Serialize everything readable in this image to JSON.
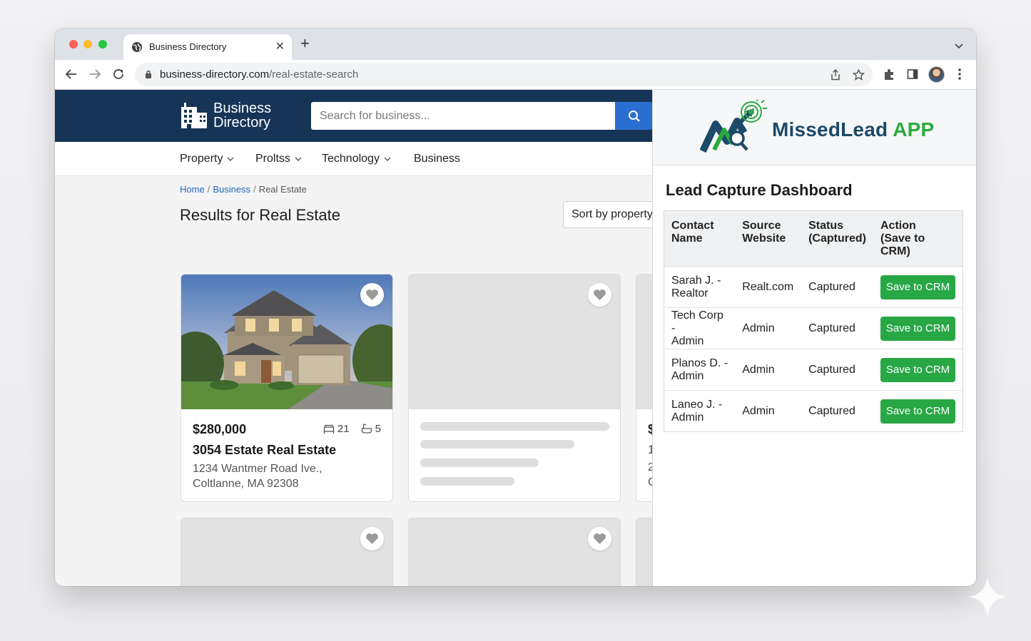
{
  "browser": {
    "tab_title": "Business Directory",
    "url_host": "business-directory.com",
    "url_path": "/real-estate-search"
  },
  "site": {
    "brand_line1": "Business",
    "brand_line2": "Directory",
    "search_placeholder": "Search for business...",
    "nav": [
      {
        "label": "Property"
      },
      {
        "label": "Proltss"
      },
      {
        "label": "Technology"
      },
      {
        "label": "Business"
      }
    ],
    "breadcrumb": {
      "home": "Home",
      "business": "Business",
      "current": "Real Estate",
      "separator": "/"
    },
    "results_title": "Results for Real Estate",
    "sort_label": "Sort by property",
    "listing": {
      "price": "$280,000",
      "beds": "21",
      "baths": "5",
      "title": "3054 Estate Real Estate",
      "address_line1": "1234 Wantmer Road Ive.,",
      "address_line2": "Coltlanne, MA 92308"
    },
    "partial_card_letters": [
      "$",
      "1",
      "2",
      "C"
    ]
  },
  "panel": {
    "app_name": "MissedLead",
    "app_suffix": "APP",
    "dashboard_title": "Lead Capture Dashboard",
    "columns": [
      {
        "line1": "Contact",
        "line2": "Name"
      },
      {
        "line1": "Source",
        "line2": "Website"
      },
      {
        "line1": "Status",
        "line2": "(Captured)"
      },
      {
        "line1": "Action",
        "line2": "(Save to CRM)"
      }
    ],
    "rows": [
      {
        "name1": "Sarah J. -",
        "name2": "Realtor",
        "source": "Realt.com",
        "status": "Captured",
        "action": "Save to CRM"
      },
      {
        "name1": "Tech Corp -",
        "name2": "Admin",
        "source": "Admin",
        "status": "Captured",
        "action": "Save to CRM"
      },
      {
        "name1": "Planos D. -",
        "name2": "Admin",
        "source": "Admin",
        "status": "Captured",
        "action": "Save to CRM"
      },
      {
        "name1": "Laneo J. -",
        "name2": "Admin",
        "source": "Admin",
        "status": "Captured",
        "action": "Save to CRM"
      }
    ]
  },
  "colors": {
    "header_navy": "#153456",
    "search_blue": "#2a6fcf",
    "crm_green": "#28a745",
    "app_navy": "#1c4a69",
    "app_green": "#2bab3e"
  }
}
